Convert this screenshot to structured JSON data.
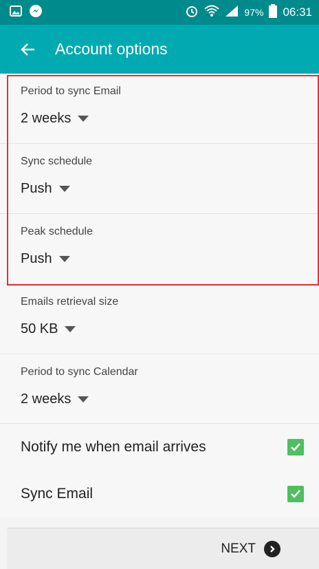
{
  "status_bar": {
    "left_icons": [
      "gallery-icon",
      "messenger-icon"
    ],
    "right_icons": [
      "alarm-icon",
      "wifi-icon",
      "signal-icon",
      "battery-icon"
    ],
    "battery_percent": "97%",
    "time": "06:31"
  },
  "app_bar": {
    "back_icon": "arrow-back-icon",
    "title": "Account options"
  },
  "settings": [
    {
      "label": "Period to sync Email",
      "value": "2 weeks"
    },
    {
      "label": "Sync schedule",
      "value": "Push"
    },
    {
      "label": "Peak schedule",
      "value": "Push"
    },
    {
      "label": "Emails retrieval size",
      "value": "50 KB"
    },
    {
      "label": "Period to sync Calendar",
      "value": "2 weeks"
    }
  ],
  "checkboxes": [
    {
      "label": "Notify me when email arrives",
      "checked": true
    },
    {
      "label": "Sync Email",
      "checked": true
    }
  ],
  "footer": {
    "next_label": "NEXT"
  },
  "colors": {
    "status_bar": "#008a8c",
    "app_bar": "#00aab0",
    "checkbox": "#4fbf5f",
    "highlight": "#e2303c"
  }
}
